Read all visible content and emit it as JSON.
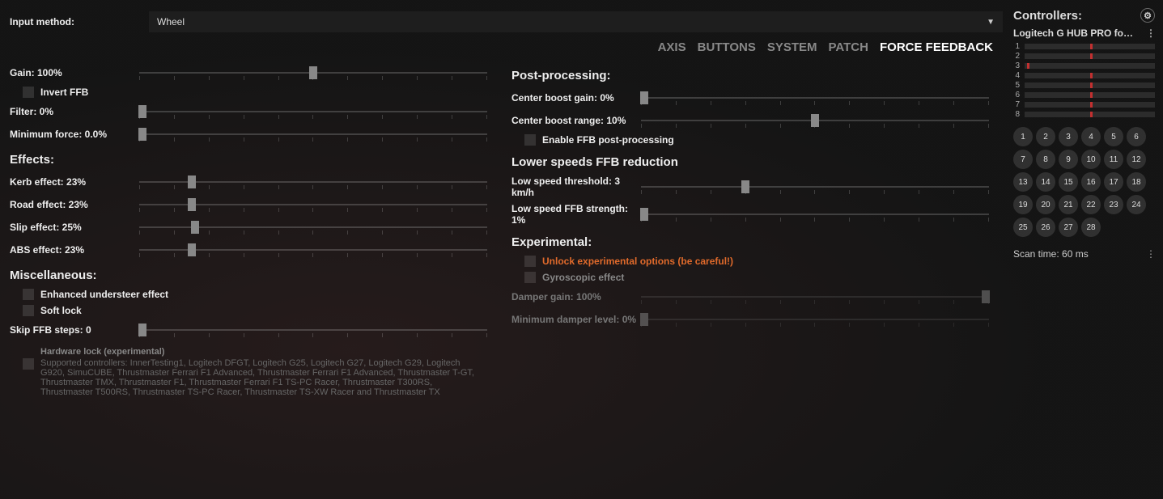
{
  "input_method_label": "Input method:",
  "input_method_value": "Wheel",
  "tabs": [
    "AXIS",
    "BUTTONS",
    "SYSTEM",
    "PATCH",
    "FORCE FEEDBACK"
  ],
  "active_tab": 4,
  "left": {
    "gain": {
      "label": "Gain: 100%",
      "pos": 50
    },
    "invert": "Invert FFB",
    "filter": {
      "label": "Filter: 0%",
      "pos": 1
    },
    "minforce": {
      "label": "Minimum force: 0.0%",
      "pos": 1
    },
    "effects_h": "Effects:",
    "kerb": {
      "label": "Kerb effect: 23%",
      "pos": 15
    },
    "road": {
      "label": "Road effect: 23%",
      "pos": 15
    },
    "slip": {
      "label": "Slip effect: 25%",
      "pos": 16
    },
    "abs": {
      "label": "ABS effect: 23%",
      "pos": 15
    },
    "misc_h": "Miscellaneous:",
    "und": "Enhanced understeer effect",
    "soft": "Soft lock",
    "skip": {
      "label": "Skip FFB steps: 0",
      "pos": 1
    },
    "hw_title": "Hardware lock (experimental)",
    "hw_body": "Supported controllers: InnerTesting1, Logitech DFGT, Logitech G25, Logitech G27, Logitech G29, Logitech G920, SimuCUBE, Thrustmaster Ferrari F1 Advanced, Thrustmaster Ferrari F1 Advanced, Thrustmaster T-GT, Thrustmaster TMX, Thrustmaster F1, Thrustmaster Ferrari F1 TS-PC Racer, Thrustmaster T300RS, Thrustmaster T500RS, Thrustmaster TS-PC Racer, Thrustmaster TS-XW Racer and Thrustmaster TX"
  },
  "right": {
    "post_h": "Post-processing:",
    "cb_gain": {
      "label": "Center boost gain: 0%",
      "pos": 1
    },
    "cb_range": {
      "label": "Center boost range: 10%",
      "pos": 50
    },
    "enable_post": "Enable FFB post-processing",
    "lower_h": "Lower speeds FFB reduction",
    "low_thr": {
      "label": "Low speed threshold: 3 km/h",
      "pos": 30
    },
    "low_str": {
      "label": "Low speed FFB strength: 1%",
      "pos": 1
    },
    "exp_h": "Experimental:",
    "unlock": "Unlock experimental options (be careful!)",
    "gyro": "Gyroscopic effect",
    "damper": {
      "label": "Damper gain: 100%",
      "pos": 99
    },
    "mindamp": {
      "label": "Minimum damper level: 0%",
      "pos": 1
    }
  },
  "sidebar": {
    "header": "Controllers:",
    "name": "Logitech G HUB PRO for Play...",
    "axes": [
      {
        "n": "1",
        "pos": 50
      },
      {
        "n": "2",
        "pos": 50
      },
      {
        "n": "3",
        "pos": 2
      },
      {
        "n": "4",
        "pos": 50
      },
      {
        "n": "5",
        "pos": 50
      },
      {
        "n": "6",
        "pos": 50
      },
      {
        "n": "7",
        "pos": 50
      },
      {
        "n": "8",
        "pos": 50
      }
    ],
    "buttons": [
      "1",
      "2",
      "3",
      "4",
      "5",
      "6",
      "7",
      "8",
      "9",
      "10",
      "11",
      "12",
      "13",
      "14",
      "15",
      "16",
      "17",
      "18",
      "19",
      "20",
      "21",
      "22",
      "23",
      "24",
      "25",
      "26",
      "27",
      "28"
    ],
    "scan": "Scan time: 60 ms"
  }
}
